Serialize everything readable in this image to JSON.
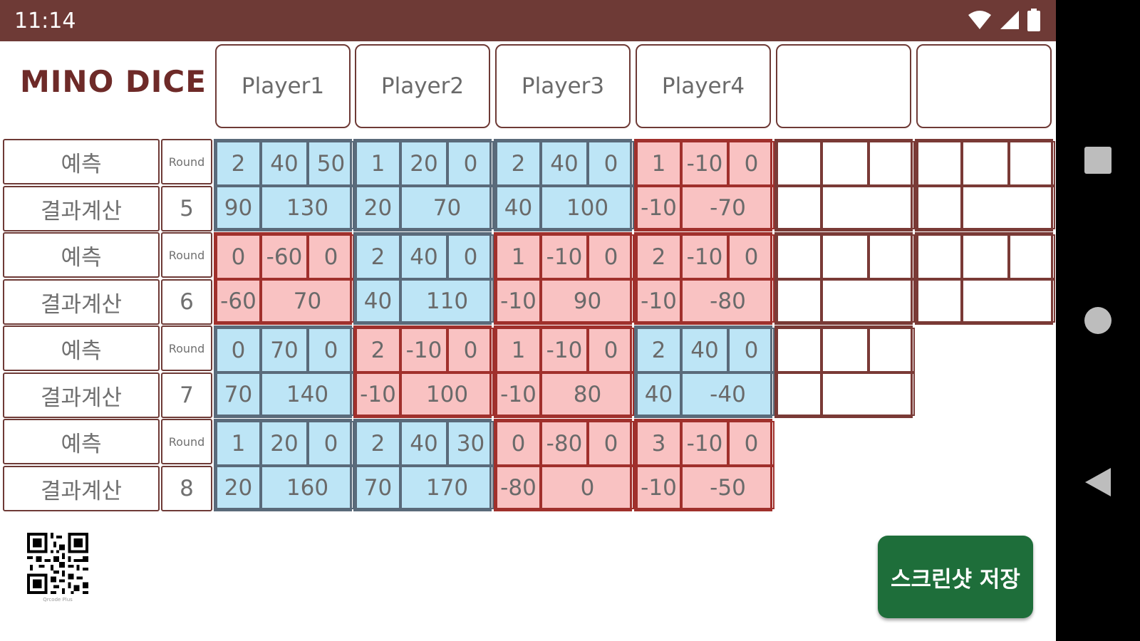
{
  "status_bar": {
    "time": "11:14"
  },
  "app_title": "MINO DICE",
  "players": [
    "Player1",
    "Player2",
    "Player3",
    "Player4",
    "",
    ""
  ],
  "labels": {
    "prediction": "예측",
    "result": "결과계산",
    "round": "Round"
  },
  "rounds": [
    {
      "number": "5",
      "blocks": [
        {
          "color": "blue",
          "prediction": [
            "2",
            "40",
            "50"
          ],
          "result": [
            "90",
            "130"
          ]
        },
        {
          "color": "blue",
          "prediction": [
            "1",
            "20",
            "0"
          ],
          "result": [
            "20",
            "70"
          ]
        },
        {
          "color": "blue",
          "prediction": [
            "2",
            "40",
            "0"
          ],
          "result": [
            "40",
            "100"
          ]
        },
        {
          "color": "red",
          "prediction": [
            "1",
            "-10",
            "0"
          ],
          "result": [
            "-10",
            "-70"
          ]
        },
        {
          "color": "empty",
          "prediction": [
            "",
            "",
            ""
          ],
          "result": [
            "",
            ""
          ]
        },
        {
          "color": "empty",
          "prediction": [
            "",
            "",
            ""
          ],
          "result": [
            "",
            ""
          ]
        }
      ]
    },
    {
      "number": "6",
      "blocks": [
        {
          "color": "red",
          "prediction": [
            "0",
            "-60",
            "0"
          ],
          "result": [
            "-60",
            "70"
          ]
        },
        {
          "color": "blue",
          "prediction": [
            "2",
            "40",
            "0"
          ],
          "result": [
            "40",
            "110"
          ]
        },
        {
          "color": "red",
          "prediction": [
            "1",
            "-10",
            "0"
          ],
          "result": [
            "-10",
            "90"
          ]
        },
        {
          "color": "red",
          "prediction": [
            "2",
            "-10",
            "0"
          ],
          "result": [
            "-10",
            "-80"
          ]
        },
        {
          "color": "empty",
          "prediction": [
            "",
            "",
            ""
          ],
          "result": [
            "",
            ""
          ]
        },
        {
          "color": "empty",
          "prediction": [
            "",
            "",
            ""
          ],
          "result": [
            "",
            ""
          ]
        }
      ]
    },
    {
      "number": "7",
      "blocks": [
        {
          "color": "blue",
          "prediction": [
            "0",
            "70",
            "0"
          ],
          "result": [
            "70",
            "140"
          ]
        },
        {
          "color": "red",
          "prediction": [
            "2",
            "-10",
            "0"
          ],
          "result": [
            "-10",
            "100"
          ]
        },
        {
          "color": "red",
          "prediction": [
            "1",
            "-10",
            "0"
          ],
          "result": [
            "-10",
            "80"
          ]
        },
        {
          "color": "blue",
          "prediction": [
            "2",
            "40",
            "0"
          ],
          "result": [
            "40",
            "-40"
          ]
        },
        {
          "color": "empty",
          "prediction": [
            "",
            "",
            ""
          ],
          "result": [
            "",
            ""
          ]
        }
      ]
    },
    {
      "number": "8",
      "blocks": [
        {
          "color": "blue",
          "prediction": [
            "1",
            "20",
            "0"
          ],
          "result": [
            "20",
            "160"
          ]
        },
        {
          "color": "blue",
          "prediction": [
            "2",
            "40",
            "30"
          ],
          "result": [
            "70",
            "170"
          ]
        },
        {
          "color": "red",
          "prediction": [
            "0",
            "-80",
            "0"
          ],
          "result": [
            "-80",
            "0"
          ]
        },
        {
          "color": "red",
          "prediction": [
            "3",
            "-10",
            "0"
          ],
          "result": [
            "-10",
            "-50"
          ]
        }
      ]
    }
  ],
  "qr_caption": "Qrcode Plus",
  "save_button": "스크린샷 저장"
}
